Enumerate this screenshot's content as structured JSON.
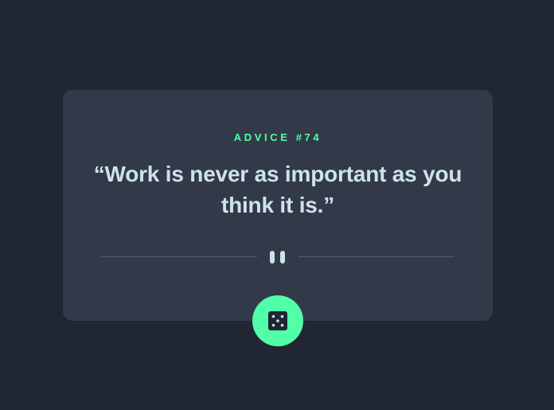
{
  "advice": {
    "id_label": "ADVICE #74",
    "text": "“Work is never as important as you think it is.”"
  },
  "icons": {
    "divider": "pause-icon",
    "button": "dice-icon"
  },
  "colors": {
    "background": "#202632",
    "card": "#323a4a",
    "accent": "#52ffa8",
    "text": "#cee3e9",
    "divider_line": "#4f5d74"
  }
}
